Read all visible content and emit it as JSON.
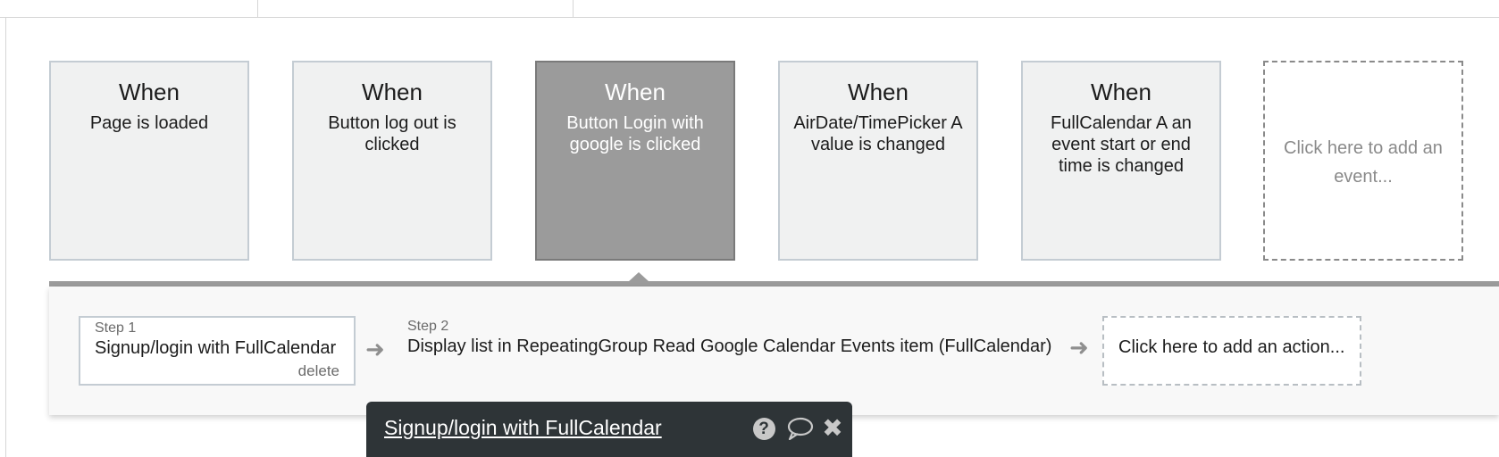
{
  "events": [
    {
      "when": "When",
      "description": "Page is loaded",
      "selected": false
    },
    {
      "when": "When",
      "description": "Button log out is clicked",
      "selected": false
    },
    {
      "when": "When",
      "description": "Button Login with google is clicked",
      "selected": true
    },
    {
      "when": "When",
      "description": "AirDate/TimePicker A value is changed",
      "selected": false
    },
    {
      "when": "When",
      "description": "FullCalendar A an event start or end time is changed",
      "selected": false
    }
  ],
  "add_event": "Click here to add an event...",
  "steps": [
    {
      "label": "Step 1",
      "text": "Signup/login with FullCalendar",
      "delete_label": "delete"
    },
    {
      "label": "Step 2",
      "text": "Display list in RepeatingGroup Read Google Calendar Events item (FullCalendar)"
    }
  ],
  "add_action": "Click here to add an action...",
  "arrow_glyph": "➜",
  "popover": {
    "title": "Signup/login with FullCalendar",
    "help_glyph": "?",
    "close_glyph": "✖",
    "icons": [
      "help-icon",
      "comment-icon",
      "close-icon"
    ]
  },
  "colors": {
    "selected_event": "#9b9b9b",
    "event_bg": "#f0f1f1",
    "popover_bg": "#2e3437"
  }
}
